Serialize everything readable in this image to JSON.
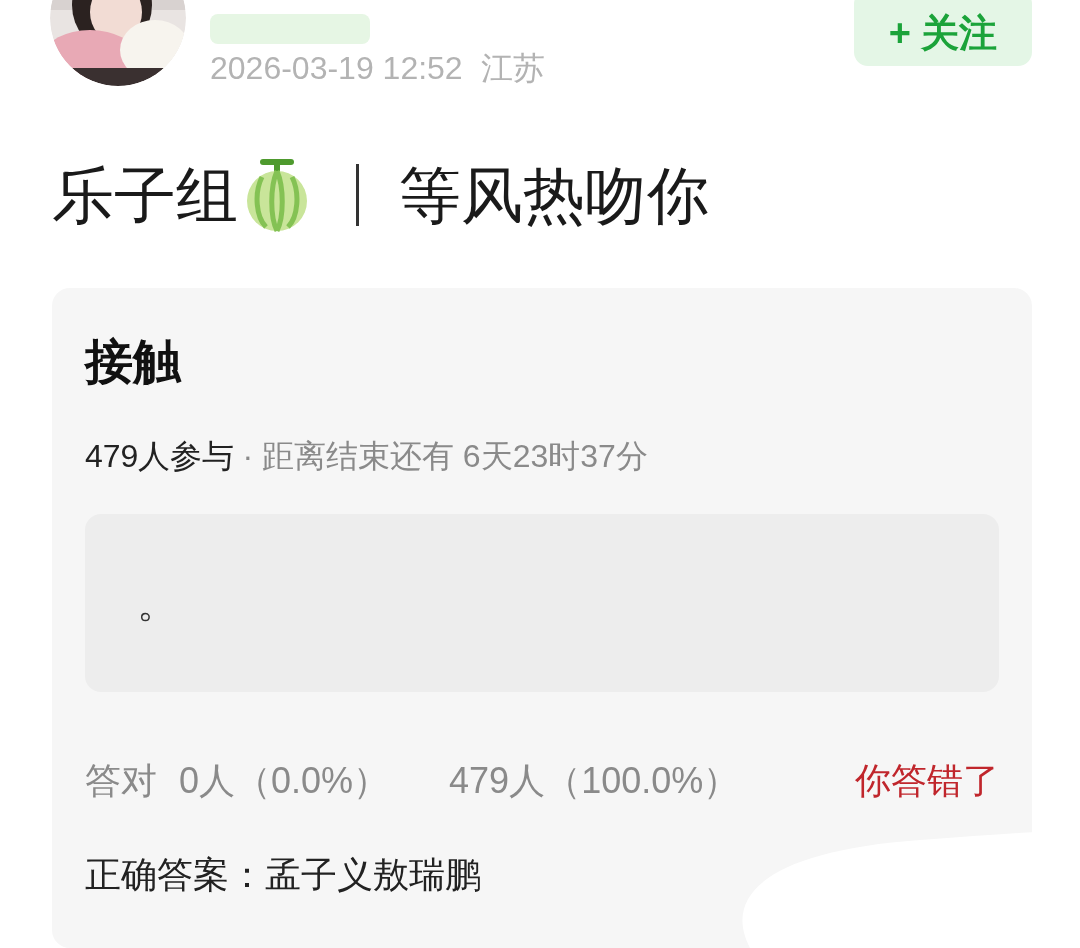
{
  "author": {
    "date": "2026-03-19 12:52",
    "location": "江苏"
  },
  "follow_button": "+ 关注",
  "post": {
    "title": "乐子组",
    "subtitle": "等风热吻你"
  },
  "quiz": {
    "title": "接触",
    "participants": "479人参与",
    "deadline": "· 距离结束还有 6天23时37分",
    "answer": "。",
    "stats": [
      {
        "label": "答对",
        "value": "0人（0.0%）"
      },
      {
        "value": "479人（100.0%）"
      }
    ],
    "result": "你答错了",
    "correct_answer": "正确答案：孟子义敖瑞鹏"
  }
}
